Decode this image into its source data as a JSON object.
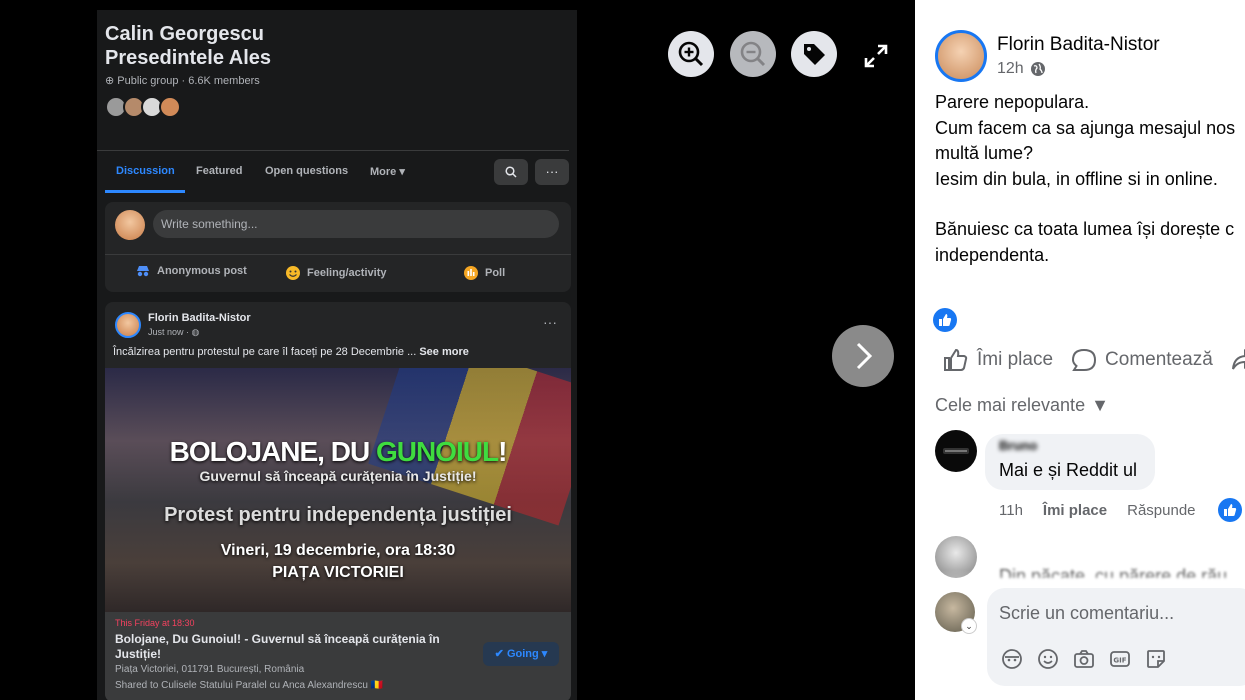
{
  "group": {
    "title_line1": "Calin Georgescu",
    "title_line2": "Presedintele Ales",
    "meta": "Public group · 6.6K members"
  },
  "tabs": [
    "Discussion",
    "Featured",
    "Open questions",
    "More"
  ],
  "composer": {
    "placeholder": "Write something...",
    "actions": [
      "Anonymous post",
      "Feeling/activity",
      "Poll"
    ]
  },
  "post": {
    "author": "Florin Badita-Nistor",
    "time": "Just now · ",
    "text": "Încălzirea pentru protestul pe care îl faceți pe 28 Decembrie ... ",
    "see_more": "See more",
    "banner": {
      "line1_a": "BOLOJANE, DU ",
      "line1_b": "GUNOIUL",
      "line1_c": "!",
      "line2": "Guvernul să înceapă curățenia în Justiție!",
      "line3": "Protest pentru independența justiției",
      "line4": "Vineri, 19 decembrie, ora 18:30",
      "line5": "PIAȚA VICTORIEI"
    },
    "event": {
      "when": "This Friday at 18:30",
      "title": "Bolojane, Du Gunoiul! - Guvernul să înceapă curățenia în Justiție!",
      "location": "Piața Victoriei, 011791 București, România",
      "shared": "Shared to Culisele Statului Paralel cu Anca Alexandrescu 🇷🇴",
      "going_label": "Going"
    }
  },
  "side": {
    "author": "Florin Badita-Nistor",
    "time": "12h",
    "text_lines": [
      "Parere nepopulara.",
      "Cum facem ca sa ajunga mesajul nos",
      "multă lume?",
      "Iesim din bula, in offline si in online.",
      "",
      "Bănuiesc ca toata lumea își dorește c",
      "independenta."
    ],
    "actions": [
      "Îmi place",
      "Comentează"
    ],
    "sort_label": "Cele mai relevante",
    "comment1": {
      "author": "Bruno",
      "text": "Mai e și Reddit ul",
      "time": "11h",
      "like": "Îmi place",
      "reply": "Răspunde"
    },
    "comment2": {
      "text": "Din păcate, cu părere de rău"
    },
    "write_placeholder": "Scrie un comentariu..."
  },
  "colors": {
    "facebook_blue": "#1877f2",
    "dark_bg": "#18191a",
    "card_bg": "#242526",
    "green_accent": "#3fdc3f"
  }
}
